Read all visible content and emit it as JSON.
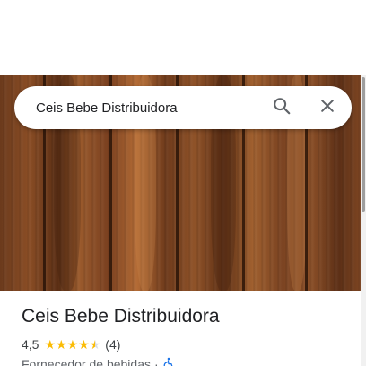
{
  "search": {
    "value": "Ceis Bebe Distribuidora",
    "search_icon": "search-icon",
    "close_icon": "close-icon"
  },
  "place": {
    "title": "Ceis Bebe Distribuidora",
    "rating": "4,5",
    "rating_stars": 4.5,
    "review_count": "(4)",
    "category": "Fornecedor de bebidas",
    "separator": "·",
    "accessibility_icon": "wheelchair-icon"
  },
  "colors": {
    "star": "#fbbc04",
    "wheelchair": "#1a73e8",
    "title_text": "#202124"
  }
}
